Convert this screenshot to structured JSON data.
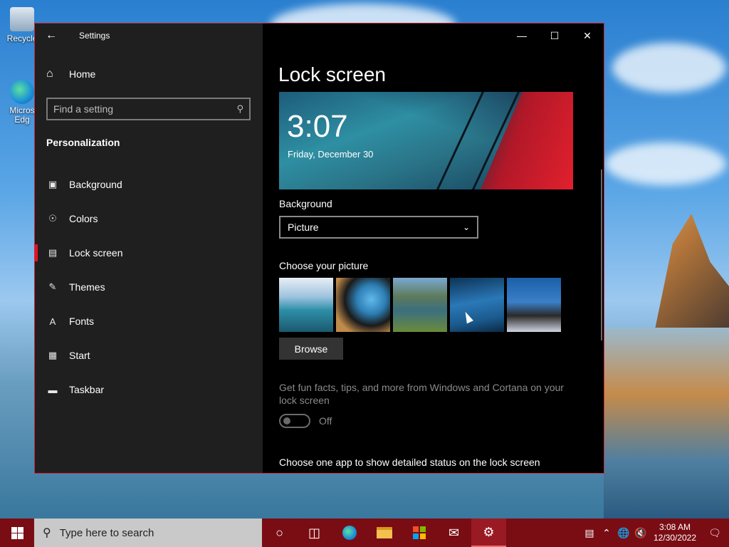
{
  "desktop": {
    "icons": [
      {
        "label": "Recycle",
        "icon": "recycle-bin-icon"
      },
      {
        "label": "Micros\nEdg",
        "icon": "edge-icon"
      }
    ]
  },
  "window": {
    "title": "Settings",
    "back_icon": "back-arrow-icon",
    "controls": {
      "minimize": "—",
      "maximize": "☐",
      "close": "✕"
    }
  },
  "sidebar": {
    "home_label": "Home",
    "search_placeholder": "Find a setting",
    "section": "Personalization",
    "items": [
      {
        "label": "Background",
        "icon": "picture-icon",
        "active": false
      },
      {
        "label": "Colors",
        "icon": "palette-icon",
        "active": false
      },
      {
        "label": "Lock screen",
        "icon": "lock-screen-icon",
        "active": true
      },
      {
        "label": "Themes",
        "icon": "themes-icon",
        "active": false
      },
      {
        "label": "Fonts",
        "icon": "fonts-icon",
        "active": false
      },
      {
        "label": "Start",
        "icon": "start-icon",
        "active": false
      },
      {
        "label": "Taskbar",
        "icon": "taskbar-icon",
        "active": false
      }
    ]
  },
  "content": {
    "page_title": "Lock screen",
    "preview": {
      "time": "3:07",
      "date": "Friday, December 30"
    },
    "background_label": "Background",
    "background_value": "Picture",
    "choose_picture_label": "Choose your picture",
    "browse_label": "Browse",
    "tips_text": "Get fun facts, tips, and more from Windows and Cortana on your lock screen",
    "toggle_state": "Off",
    "detailed_status_label": "Choose one app to show detailed status on the lock screen"
  },
  "taskbar": {
    "search_placeholder": "Type here to search",
    "apps": [
      "cortana-icon",
      "task-view-icon",
      "edge-icon",
      "file-explorer-icon",
      "store-icon",
      "mail-icon",
      "settings-icon"
    ],
    "time": "3:08 AM",
    "date": "12/30/2022"
  },
  "colors": {
    "accent": "#e81123",
    "taskbar": "#7a0d14",
    "window_border": "#c42b3c"
  }
}
